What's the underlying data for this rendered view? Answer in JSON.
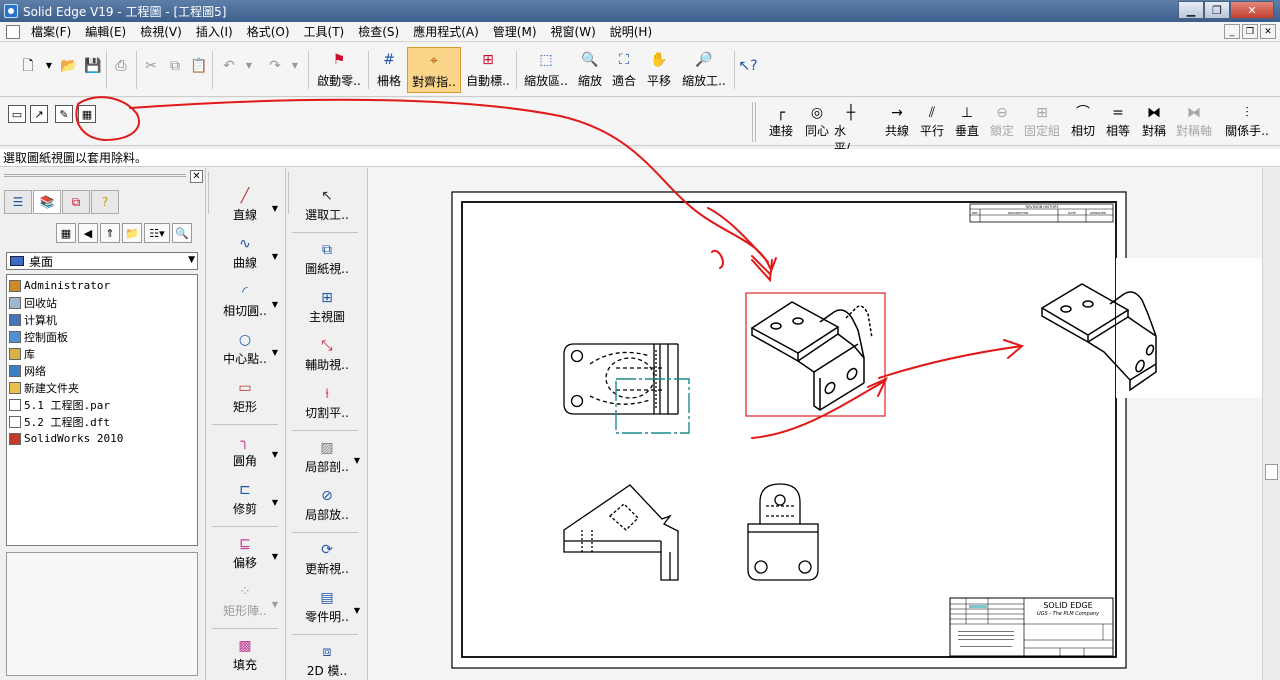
{
  "window": {
    "title": "Solid Edge V19 - 工程圖 - [工程圖5]"
  },
  "menu": [
    "檔案(F)",
    "編輯(E)",
    "檢視(V)",
    "插入(I)",
    "格式(O)",
    "工具(T)",
    "檢查(S)",
    "應用程式(A)",
    "管理(M)",
    "視窗(W)",
    "說明(H)"
  ],
  "toolbar": {
    "start_cmd": "啟動零..",
    "grid": "柵格",
    "align_indicator": "對齊指..",
    "auto_label": "自動標..",
    "zoom_area": "縮放區..",
    "zoom": "縮放",
    "fit": "適合",
    "pan": "平移",
    "zoom_tool": "縮放工.."
  },
  "relations": [
    {
      "label": "連接",
      "icon": "┌",
      "disabled": false
    },
    {
      "label": "同心",
      "icon": "◎",
      "disabled": false
    },
    {
      "label": "水平/..",
      "icon": "┼",
      "disabled": false
    },
    {
      "label": "共線",
      "icon": "→",
      "disabled": false
    },
    {
      "label": "平行",
      "icon": "⫽",
      "disabled": false
    },
    {
      "label": "垂直",
      "icon": "⊥",
      "disabled": false
    },
    {
      "label": "鎖定",
      "icon": "⊖",
      "disabled": true
    },
    {
      "label": "固定組",
      "icon": "⊞",
      "disabled": true
    },
    {
      "label": "相切",
      "icon": "⌒",
      "disabled": false
    },
    {
      "label": "相等",
      "icon": "=",
      "disabled": false
    },
    {
      "label": "對稱",
      "icon": "⧓",
      "disabled": false
    },
    {
      "label": "對稱軸",
      "icon": "⧓",
      "disabled": true
    },
    {
      "label": "關係手..",
      "icon": "⫶",
      "disabled": false
    }
  ],
  "status": {
    "prompt": "選取圖紙視圖以套用除料。"
  },
  "library": {
    "location": "桌面",
    "items": [
      {
        "name": "Administrator",
        "color": "#c98b2e"
      },
      {
        "name": "回收站",
        "color": "#9fb6cf"
      },
      {
        "name": "计算机",
        "color": "#4a73b8"
      },
      {
        "name": "控制面板",
        "color": "#4f8fd2"
      },
      {
        "name": "库",
        "color": "#d8b04a"
      },
      {
        "name": "网络",
        "color": "#3c7fc4"
      },
      {
        "name": "新建文件夹",
        "color": "#e8c04e"
      },
      {
        "name": "5.1 工程图.par",
        "color": "#ffffff"
      },
      {
        "name": "5.2 工程图.dft",
        "color": "#ffffff"
      },
      {
        "name": "SolidWorks 2010",
        "color": "#c23a2c"
      }
    ]
  },
  "draw_tools": {
    "line": "直線",
    "curve": "曲線",
    "tangent_arc": "相切圓..",
    "center_point": "中心點..",
    "rectangle": "矩形",
    "fillet": "圓角",
    "trim": "修剪",
    "offset": "偏移",
    "rect_array": "矩形陣..",
    "fill": "填充"
  },
  "view_tools": {
    "select": "選取工..",
    "drawing_view": "圖紙視..",
    "principal_view": "主視圖",
    "auxiliary_view": "輔助視..",
    "section_plane": "切割平..",
    "broken_out": "局部剖..",
    "detail": "局部放..",
    "update_views": "更新視..",
    "parts_list": "零件明..",
    "model_2d": "2D 模.."
  },
  "title_block": {
    "company": "SOLID EDGE",
    "subtitle": "UGS - The PLM Company",
    "revision": "REVISION HISTORY",
    "rev_cols": [
      "REV",
      "DESCRIPTION",
      "DATE",
      "APPROVED"
    ]
  }
}
